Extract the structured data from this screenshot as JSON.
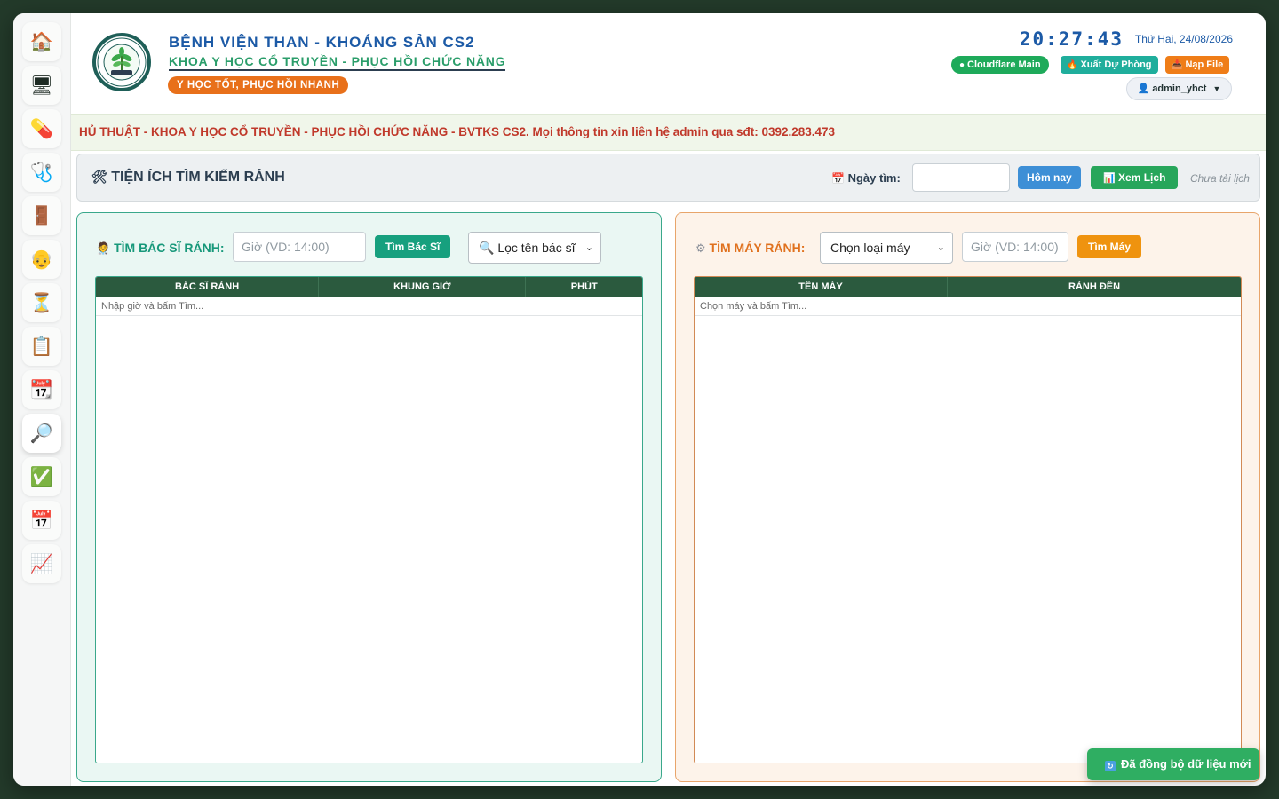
{
  "sidebar": {
    "items": [
      {
        "icon": "home-icon",
        "glyph": "🏠"
      },
      {
        "icon": "monitor-icon",
        "glyph": "🖥"
      },
      {
        "icon": "pill-icon",
        "glyph": "💊"
      },
      {
        "icon": "stethoscope-icon",
        "glyph": "🩺"
      },
      {
        "icon": "door-icon",
        "glyph": "🚪"
      },
      {
        "icon": "person-icon",
        "glyph": "👴"
      },
      {
        "icon": "hourglass-icon",
        "glyph": "⏳"
      },
      {
        "icon": "clipboard-icon",
        "glyph": "📋"
      },
      {
        "icon": "calendar-icon",
        "glyph": "📆"
      },
      {
        "icon": "magnifier-icon",
        "glyph": "🔎"
      },
      {
        "icon": "checkmark-icon",
        "glyph": "✅"
      },
      {
        "icon": "calendar-grid-icon",
        "glyph": "📅"
      },
      {
        "icon": "chart-icon",
        "glyph": "📈"
      }
    ],
    "active_index": 9
  },
  "header": {
    "title": "BỆNH VIỆN THAN - KHOÁNG SẢN CS2",
    "subtitle": "KHOA Y HỌC CỔ TRUYỀN - PHỤC HỒI CHỨC NĂNG",
    "slogan": "Y HỌC TỐT, PHỤC HỒI NHANH",
    "clock": "20:27:43",
    "date": "Thứ Hai, 24/08/2026",
    "buttons": {
      "cloudflare": "Cloudflare Main",
      "export": "Xuất Dự Phòng",
      "load": "Nạp File"
    },
    "user": "admin_yhct"
  },
  "marquee": "HỦ THUẬT - KHOA Y HỌC CỔ TRUYỀN - PHỤC HỒI CHỨC NĂNG - BVTKS CS2. Mọi thông tin xin liên hệ admin qua sđt: 0392.283.473",
  "toolbar": {
    "title": "TIỆN ÍCH TÌM KIẾM RẢNH",
    "date_label": "Ngày tìm:",
    "date_value": "",
    "today_button": "Hôm nay",
    "view_button": "Xem Lịch",
    "status": "Chưa tải lịch"
  },
  "doctor_panel": {
    "title": "TÌM BÁC SĨ RẢNH:",
    "time_placeholder": "Giờ (VD: 14:00)",
    "search_button": "Tìm Bác Sĩ",
    "filter_select": "🔍 Lọc tên bác sĩ",
    "columns": [
      "BÁC SĨ RẢNH",
      "KHUNG GIỜ",
      "PHÚT"
    ],
    "empty_text": "Nhập giờ và bấm Tìm..."
  },
  "machine_panel": {
    "title": "TÌM MÁY RẢNH:",
    "type_select": "Chọn loại máy",
    "time_placeholder": "Giờ (VD: 14:00)",
    "search_button": "Tìm Máy",
    "columns": [
      "TÊN MÁY",
      "RẢNH ĐẾN"
    ],
    "empty_text": "Chọn máy và bấm Tìm..."
  },
  "toast": "Đã đồng bộ dữ liệu mới",
  "colors": {
    "primary_blue": "#1c5aa6",
    "primary_green": "#2a9d6a",
    "accent_orange": "#e8701a",
    "table_header": "#2b5a3e",
    "marquee_red": "#c0392b"
  }
}
